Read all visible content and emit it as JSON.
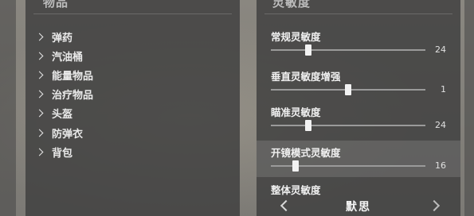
{
  "left_panel": {
    "title": "物品",
    "items": [
      {
        "label": "弹药"
      },
      {
        "label": "汽油桶"
      },
      {
        "label": "能量物品"
      },
      {
        "label": "治疗物品"
      },
      {
        "label": "头盔"
      },
      {
        "label": "防弹衣"
      },
      {
        "label": "背包"
      }
    ]
  },
  "right_panel": {
    "title": "灵敏度",
    "settings": [
      {
        "label": "常规灵敏度",
        "value": "24",
        "level": 0.24
      },
      {
        "label": "垂直灵敏度增强",
        "value": "1",
        "level": 0.5
      },
      {
        "label": "瞄准灵敏度",
        "value": "24",
        "level": 0.24
      },
      {
        "label": "开镜模式灵敏度",
        "value": "16",
        "level": 0.16
      },
      {
        "label": "整体灵敏度",
        "value": "",
        "level": null
      }
    ]
  },
  "bottom": {
    "partial_text": "默思"
  }
}
